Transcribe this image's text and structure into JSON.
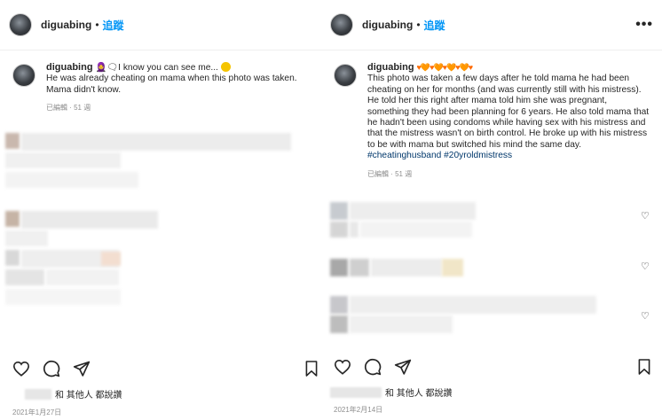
{
  "left": {
    "header": {
      "username": "diguabing",
      "separator": "•",
      "follow": "追蹤",
      "more": "•••"
    },
    "caption": {
      "username": "diguabing",
      "icons": "🧕🗨",
      "text": "I know you can see me... ",
      "emoji": "😑",
      "line2": "He was already cheating on mama when this photo was taken. Mama didn't know.",
      "meta": "已編輯 · 51 週"
    },
    "likes_text": "和 其他人 都說讚",
    "date": "2021年1月27日"
  },
  "right": {
    "header": {
      "username": "diguabing",
      "separator": "•",
      "follow": "追蹤",
      "more": "•••"
    },
    "caption": {
      "username": "diguabing",
      "hearts": "♥🧡♥🧡♥🧡♥🧡♥",
      "text": "This photo was taken a few days after he told mama he had been cheating on her for months (and was currently still with his mistress). He told her this right after mama told him she was pregnant, something they had been planning for 6 years. He also told mama that he hadn't been using condoms while having sex with his mistress and that the mistress wasn't on birth control. He broke up with his mistress to be with mama but switched his mind the same day. ",
      "hashtag1": "#cheatinghusband",
      "hashtag2": "#20yroldmistress",
      "meta": "已編輯 · 51 週"
    },
    "likes_text": "和 其他人 都說讚",
    "date": "2021年2月14日"
  },
  "icons": {
    "heart": "heart-icon",
    "comment": "comment-icon",
    "share": "paper-plane-icon",
    "save": "bookmark-icon",
    "small_heart": "♡"
  },
  "colors": {
    "link": "#0095f6",
    "hashtag": "#00376b",
    "meta": "#8e8e8e"
  }
}
